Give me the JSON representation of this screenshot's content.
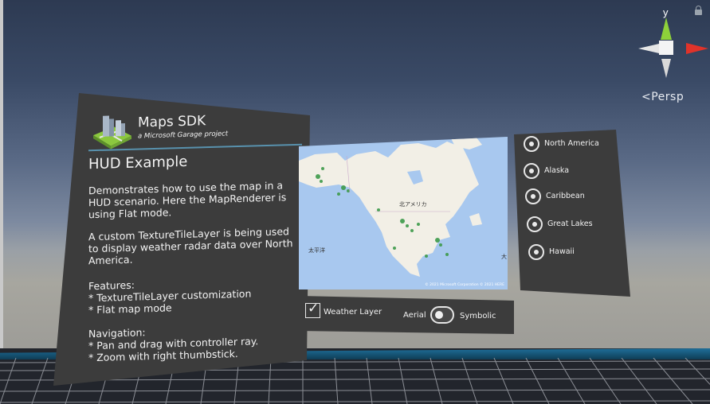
{
  "scene": {
    "view_mode": "Persp",
    "gizmo_axis_label": "y"
  },
  "info_panel": {
    "brand_title": "Maps SDK",
    "brand_subtitle": "a Microsoft Garage project",
    "title": "HUD Example",
    "description": "Demonstrates how to use the map in a HUD scenario. Here the MapRenderer is using Flat mode.",
    "weather_note": "A custom TextureTileLayer is being used to display weather radar data over North America.",
    "features_heading": "Features:",
    "features": [
      "* TextureTileLayer customization",
      "* Flat map mode"
    ],
    "navigation_heading": "Navigation:",
    "navigation": [
      "* Pan and drag with controller ray.",
      "* Zoom with right thumbstick."
    ]
  },
  "map": {
    "label_continent": "北アメリカ",
    "label_pacific": "太平洋",
    "label_atlantic": "大",
    "attribution": "© 2021 Microsoft Corporation © 2021 HERE"
  },
  "controls": {
    "weather_layer_label": "Weather Layer",
    "weather_layer_checked": true,
    "aerial_label": "Aerial",
    "symbolic_label": "Symbolic"
  },
  "regions": {
    "items": [
      {
        "label": "North America"
      },
      {
        "label": "Alaska"
      },
      {
        "label": "Caribbean"
      },
      {
        "label": "Great Lakes"
      },
      {
        "label": "Hawaii"
      }
    ]
  },
  "colors": {
    "panel": "#3c3c3c",
    "ocean": "#a8c8ef",
    "land": "#f2efe6",
    "radar": "#3d9a4a",
    "gizmo_y": "#8ed13a",
    "gizmo_x": "#e0332a",
    "floor_edge": "#1f6f9a"
  }
}
